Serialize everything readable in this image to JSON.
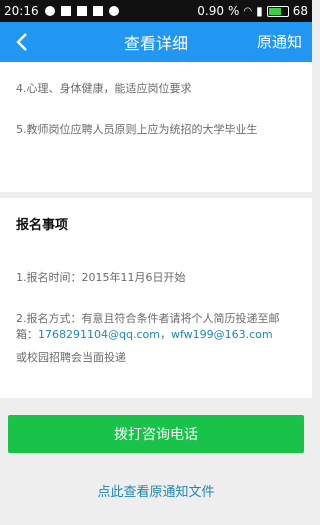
{
  "status_bar": {
    "time": "20:16",
    "network_speed": "0.90",
    "network_unit": "%",
    "battery": "68"
  },
  "header": {
    "title": "查看详细",
    "action_label": "原通知"
  },
  "details": {
    "item4": "4.心理、身体健康，能适应岗位要求",
    "item5": "5.教师岗位应聘人员原则上应为统招的大学毕业生"
  },
  "registration": {
    "title": "报名事项",
    "time": "1.报名时间：2015年11月6日开始",
    "method_text": "2.报名方式：有意且符合条件者请将个人简历投递至邮箱：",
    "email1": "1768291104@qq.com",
    "separator": "，",
    "email2": "wfw199@163.com",
    "alt_method": "或校园招聘会当面投递"
  },
  "buttons": {
    "call_label": "拨打咨询电话",
    "view_original_label": "点此查看原通知文件"
  },
  "colors": {
    "header_bg": "#2196f3",
    "call_button_bg": "#19c34a",
    "link": "#1f87b3"
  }
}
